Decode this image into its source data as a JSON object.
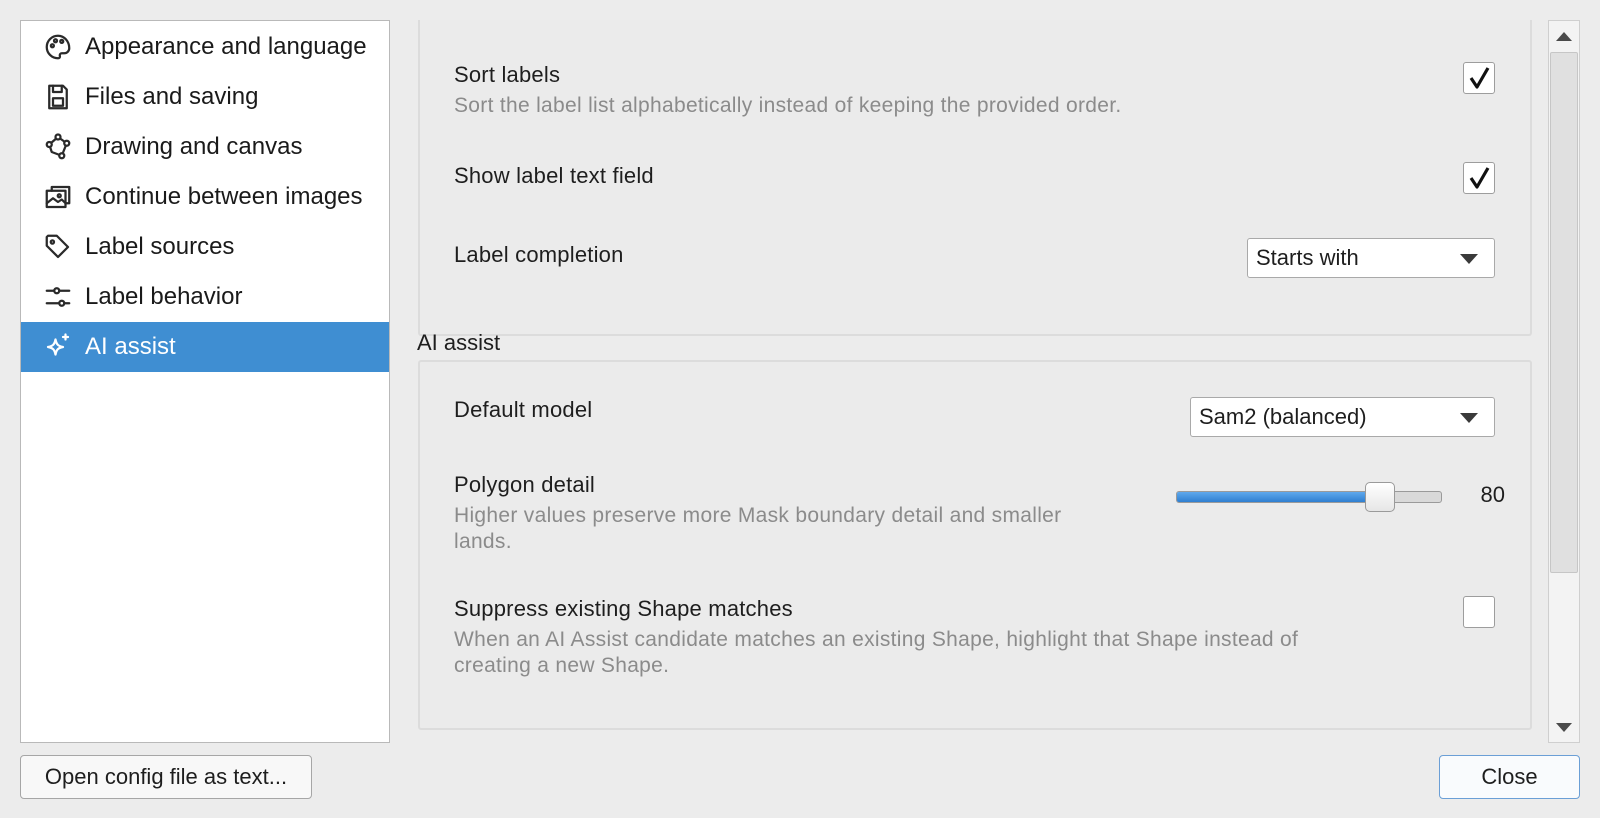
{
  "sidebar": {
    "items": [
      {
        "label": "Appearance and language",
        "icon": "palette-icon"
      },
      {
        "label": "Files and saving",
        "icon": "save-icon"
      },
      {
        "label": "Drawing and canvas",
        "icon": "polygon-icon"
      },
      {
        "label": "Continue between images",
        "icon": "images-icon"
      },
      {
        "label": "Label sources",
        "icon": "tag-icon"
      },
      {
        "label": "Label behavior",
        "icon": "sliders-icon"
      },
      {
        "label": "AI assist",
        "icon": "sparkle-icon"
      }
    ],
    "selected": "AI assist",
    "selected_color": "#3f8ed2"
  },
  "label_section": {
    "sort_labels": {
      "label": "Sort labels",
      "description": "Sort the label list alphabetically instead of keeping the provided order.",
      "checked": true
    },
    "show_label_text_field": {
      "label": "Show label text field",
      "checked": true
    },
    "label_completion": {
      "label": "Label completion",
      "value": "Starts with"
    }
  },
  "ai_section": {
    "title": "AI assist",
    "default_model": {
      "label": "Default model",
      "value": "Sam2 (balanced)"
    },
    "polygon_detail": {
      "label": "Polygon detail",
      "description_line1": "Higher values preserve more Mask boundary detail and smaller",
      "description_line2": "lands.",
      "value": 80,
      "value_text": "80",
      "min": 0,
      "max": 100
    },
    "suppress_matches": {
      "label": "Suppress existing Shape matches",
      "description_line1": "When an AI Assist candidate matches an existing Shape, highlight that Shape instead of",
      "description_line2": "creating a new Shape.",
      "checked": false
    }
  },
  "footer": {
    "open_config_label": "Open config file as text...",
    "close_label": "Close"
  }
}
